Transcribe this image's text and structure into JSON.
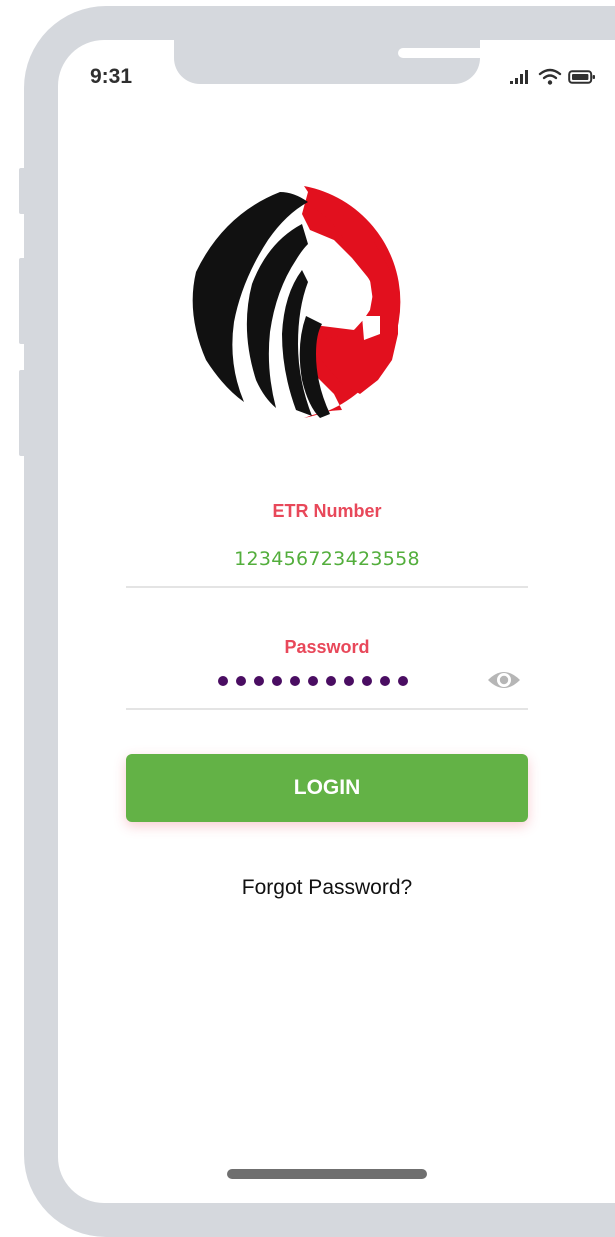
{
  "status_bar": {
    "time": "9:31",
    "icons": [
      "signal-icon",
      "wifi-icon",
      "battery-icon"
    ]
  },
  "logo": {
    "name": "lion-logo",
    "colors": {
      "black": "#111111",
      "red": "#e2101e"
    }
  },
  "form": {
    "etr_label": "ETR Number",
    "etr_value": "123456723423558",
    "password_label": "Password",
    "password_mask_length": 11,
    "password_visibility_icon": "eye-icon"
  },
  "actions": {
    "login_label": "LOGIN",
    "forgot_label": "Forgot Password?"
  },
  "colors": {
    "accent_label": "#e8485a",
    "value_green": "#53ae3c",
    "login_button": "#63b246",
    "password_dots": "#4a0d62",
    "frame": "#d5d8dd"
  }
}
